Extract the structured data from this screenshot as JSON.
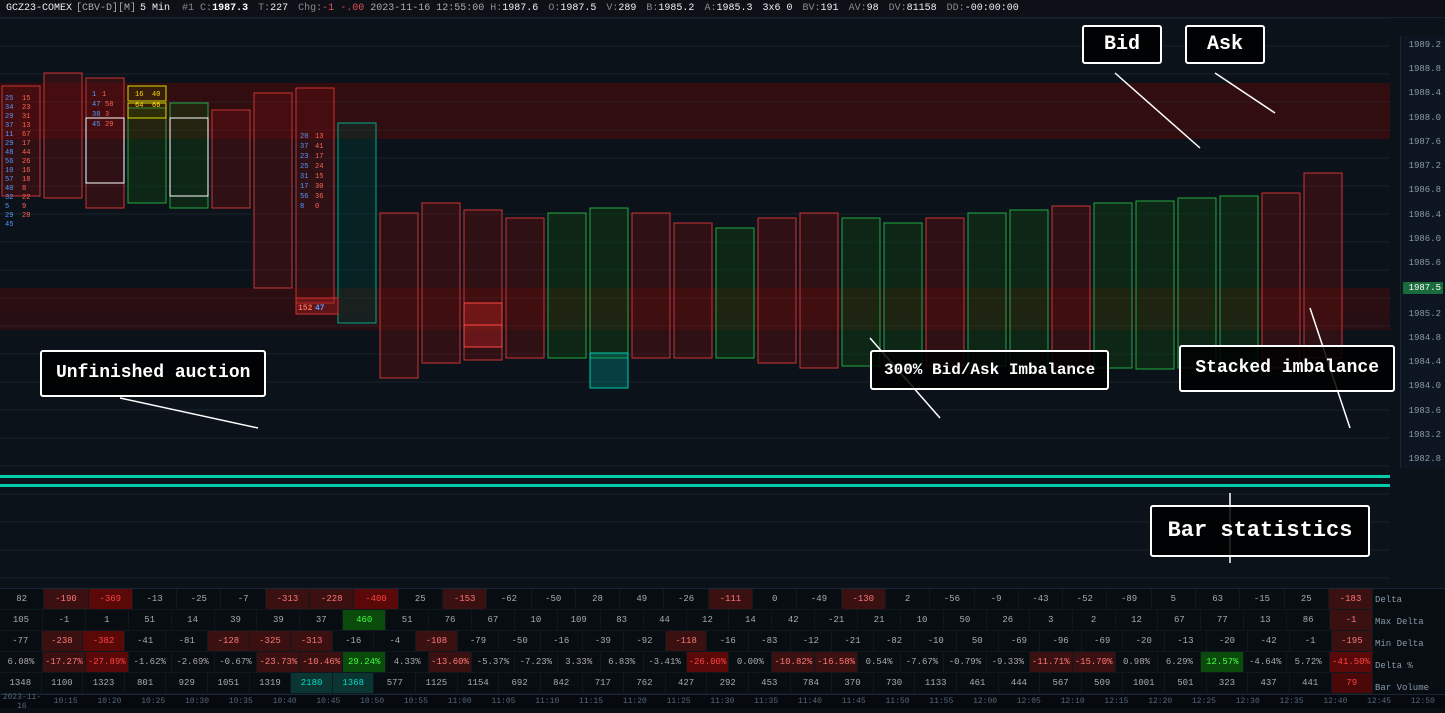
{
  "header": {
    "symbol": "GCZ23-COMEX",
    "mode": "[CBV-D][M]",
    "timeframe": "5 Min",
    "bar_num": "#1 C:",
    "close": "1987.3",
    "T": "227",
    "Chg": "-1",
    "ChgPct": "-.00",
    "date": "2023-11-16 12:55:00",
    "H": "1987.6",
    "O": "1987.5",
    "V": "289",
    "B": "1985.2",
    "A": "1985.3",
    "x3x0": "3x6 0",
    "BV": "191",
    "AV": "98",
    "DV": "81158",
    "DD": "-00:00:00"
  },
  "annotations": {
    "unfinished_auction": "Unfinished\nauction",
    "stacked_imbalance": "Stacked\nimbalance",
    "bid_ask_imbalance": "300% Bid/Ask\nImbalance",
    "bar_statistics": "Bar statistics",
    "bid_label": "Bid",
    "ask_label": "Ask"
  },
  "price_levels": [
    "1989.2",
    "1988.8",
    "1988.4",
    "1988.0",
    "1987.6",
    "1987.2",
    "1986.8",
    "1986.4",
    "1986.0",
    "1985.6",
    "1985.2",
    "1984.8",
    "1984.4",
    "1984.0",
    "1983.6",
    "1983.2",
    "1982.8"
  ],
  "current_price": "1987.5",
  "stats": {
    "rows": [
      {
        "label": "Delta",
        "cells": [
          {
            "val": "82",
            "type": "neutral"
          },
          {
            "val": "-190",
            "type": "neg"
          },
          {
            "val": "-369",
            "type": "strong-neg"
          },
          {
            "val": "-13",
            "type": "neutral"
          },
          {
            "val": "-25",
            "type": "neutral"
          },
          {
            "val": "-7",
            "type": "neutral"
          },
          {
            "val": "-313",
            "type": "neg"
          },
          {
            "val": "-228",
            "type": "neg"
          },
          {
            "val": "-400",
            "type": "strong-neg"
          },
          {
            "val": "25",
            "type": "neutral"
          },
          {
            "val": "-153",
            "type": "neg"
          },
          {
            "val": "-62",
            "type": "neutral"
          },
          {
            "val": "-50",
            "type": "neutral"
          },
          {
            "val": "28",
            "type": "neutral"
          },
          {
            "val": "49",
            "type": "neutral"
          },
          {
            "val": "-26",
            "type": "neutral"
          },
          {
            "val": "-111",
            "type": "neg"
          },
          {
            "val": "0",
            "type": "neutral"
          },
          {
            "val": "-49",
            "type": "neutral"
          },
          {
            "val": "-130",
            "type": "neg"
          },
          {
            "val": "2",
            "type": "neutral"
          },
          {
            "val": "-56",
            "type": "neutral"
          },
          {
            "val": "-9",
            "type": "neutral"
          },
          {
            "val": "-43",
            "type": "neutral"
          },
          {
            "val": "-52",
            "type": "neutral"
          },
          {
            "val": "-89",
            "type": "neutral"
          },
          {
            "val": "5",
            "type": "neutral"
          },
          {
            "val": "63",
            "type": "neutral"
          },
          {
            "val": "-15",
            "type": "neutral"
          },
          {
            "val": "25",
            "type": "neutral"
          },
          {
            "val": "-183",
            "type": "neg"
          },
          {
            "val": "Delta",
            "type": "label"
          }
        ]
      },
      {
        "label": "Max Delta",
        "cells": [
          {
            "val": "105",
            "type": "neutral"
          },
          {
            "val": "-1",
            "type": "neutral"
          },
          {
            "val": "1",
            "type": "neutral"
          },
          {
            "val": "51",
            "type": "neutral"
          },
          {
            "val": "14",
            "type": "neutral"
          },
          {
            "val": "39",
            "type": "neutral"
          },
          {
            "val": "39",
            "type": "neutral"
          },
          {
            "val": "37",
            "type": "neutral"
          },
          {
            "val": "460",
            "type": "strong-pos"
          },
          {
            "val": "51",
            "type": "neutral"
          },
          {
            "val": "76",
            "type": "neutral"
          },
          {
            "val": "67",
            "type": "neutral"
          },
          {
            "val": "10",
            "type": "neutral"
          },
          {
            "val": "109",
            "type": "neutral"
          },
          {
            "val": "83",
            "type": "neutral"
          },
          {
            "val": "44",
            "type": "neutral"
          },
          {
            "val": "12",
            "type": "neutral"
          },
          {
            "val": "14",
            "type": "neutral"
          },
          {
            "val": "42",
            "type": "neutral"
          },
          {
            "val": "-21",
            "type": "neutral"
          },
          {
            "val": "21",
            "type": "neutral"
          },
          {
            "val": "10",
            "type": "neutral"
          },
          {
            "val": "50",
            "type": "neutral"
          },
          {
            "val": "26",
            "type": "neutral"
          },
          {
            "val": "3",
            "type": "neutral"
          },
          {
            "val": "2",
            "type": "neutral"
          },
          {
            "val": "12",
            "type": "neutral"
          },
          {
            "val": "67",
            "type": "neutral"
          },
          {
            "val": "77",
            "type": "neutral"
          },
          {
            "val": "13",
            "type": "neutral"
          },
          {
            "val": "86",
            "type": "neutral"
          },
          {
            "val": "-1",
            "type": "neg"
          },
          {
            "val": "Max Delta",
            "type": "label"
          }
        ]
      },
      {
        "label": "Min Delta",
        "cells": [
          {
            "val": "-77",
            "type": "neutral"
          },
          {
            "val": "-238",
            "type": "neg"
          },
          {
            "val": "-382",
            "type": "strong-neg"
          },
          {
            "val": "-41",
            "type": "neutral"
          },
          {
            "val": "-81",
            "type": "neutral"
          },
          {
            "val": "-128",
            "type": "neg"
          },
          {
            "val": "-325",
            "type": "neg"
          },
          {
            "val": "-313",
            "type": "neg"
          },
          {
            "val": "-16",
            "type": "neutral"
          },
          {
            "val": "-4",
            "type": "neutral"
          },
          {
            "val": "-108",
            "type": "neg"
          },
          {
            "val": "-79",
            "type": "neutral"
          },
          {
            "val": "-50",
            "type": "neutral"
          },
          {
            "val": "-16",
            "type": "neutral"
          },
          {
            "val": "-39",
            "type": "neutral"
          },
          {
            "val": "-92",
            "type": "neutral"
          },
          {
            "val": "-118",
            "type": "neg"
          },
          {
            "val": "-16",
            "type": "neutral"
          },
          {
            "val": "-83",
            "type": "neutral"
          },
          {
            "val": "-12",
            "type": "neutral"
          },
          {
            "val": "-21",
            "type": "neutral"
          },
          {
            "val": "-82",
            "type": "neutral"
          },
          {
            "val": "-10",
            "type": "neutral"
          },
          {
            "val": "50",
            "type": "neutral"
          },
          {
            "val": "-69",
            "type": "neutral"
          },
          {
            "val": "-96",
            "type": "neutral"
          },
          {
            "val": "-69",
            "type": "neutral"
          },
          {
            "val": "-20",
            "type": "neutral"
          },
          {
            "val": "-13",
            "type": "neutral"
          },
          {
            "val": "-20",
            "type": "neutral"
          },
          {
            "val": "-42",
            "type": "neutral"
          },
          {
            "val": "-1",
            "type": "neutral"
          },
          {
            "val": "-195",
            "type": "neg"
          },
          {
            "val": "Min Delta",
            "type": "label"
          }
        ]
      },
      {
        "label": "Delta %",
        "cells": [
          {
            "val": "6.08%",
            "type": "neutral"
          },
          {
            "val": "-17.27%",
            "type": "neg"
          },
          {
            "val": "-27.89%",
            "type": "strong-neg"
          },
          {
            "val": "-1.62%",
            "type": "neutral"
          },
          {
            "val": "-2.69%",
            "type": "neutral"
          },
          {
            "val": "-0.67%",
            "type": "neutral"
          },
          {
            "val": "-23.73%",
            "type": "neg"
          },
          {
            "val": "-10.46%",
            "type": "neg"
          },
          {
            "val": "29.24%",
            "type": "strong-pos"
          },
          {
            "val": "4.33%",
            "type": "neutral"
          },
          {
            "val": "-13.60%",
            "type": "neg"
          },
          {
            "val": "-5.37%",
            "type": "neutral"
          },
          {
            "val": "-7.23%",
            "type": "neutral"
          },
          {
            "val": "3.33%",
            "type": "neutral"
          },
          {
            "val": "6.83%",
            "type": "neutral"
          },
          {
            "val": "-3.41%",
            "type": "neutral"
          },
          {
            "val": "-26.00%",
            "type": "strong-neg"
          },
          {
            "val": "0.00%",
            "type": "neutral"
          },
          {
            "val": "-10.82%",
            "type": "neg"
          },
          {
            "val": "-16.58%",
            "type": "neg"
          },
          {
            "val": "0.54%",
            "type": "neutral"
          },
          {
            "val": "-7.67%",
            "type": "neutral"
          },
          {
            "val": "-0.79%",
            "type": "neutral"
          },
          {
            "val": "-9.33%",
            "type": "neutral"
          },
          {
            "val": "-11.71%",
            "type": "neg"
          },
          {
            "val": "-15.70%",
            "type": "neg"
          },
          {
            "val": "0.98%",
            "type": "neutral"
          },
          {
            "val": "6.29%",
            "type": "neutral"
          },
          {
            "val": "12.57%",
            "type": "strong-pos"
          },
          {
            "val": "-4.64%",
            "type": "neutral"
          },
          {
            "val": "5.72%",
            "type": "neutral"
          },
          {
            "val": "-41.50%",
            "type": "strong-neg"
          },
          {
            "val": "Delta %",
            "type": "label"
          }
        ]
      },
      {
        "label": "Bar Volume",
        "cells": [
          {
            "val": "1348",
            "type": "neutral"
          },
          {
            "val": "1100",
            "type": "neutral"
          },
          {
            "val": "1323",
            "type": "neutral"
          },
          {
            "val": "801",
            "type": "neutral"
          },
          {
            "val": "929",
            "type": "neutral"
          },
          {
            "val": "1051",
            "type": "neutral"
          },
          {
            "val": "1319",
            "type": "neutral"
          },
          {
            "val": "2180",
            "type": "highlight-teal"
          },
          {
            "val": "1368",
            "type": "highlight-teal"
          },
          {
            "val": "577",
            "type": "neutral"
          },
          {
            "val": "1125",
            "type": "neutral"
          },
          {
            "val": "1154",
            "type": "neutral"
          },
          {
            "val": "692",
            "type": "neutral"
          },
          {
            "val": "842",
            "type": "neutral"
          },
          {
            "val": "717",
            "type": "neutral"
          },
          {
            "val": "762",
            "type": "neutral"
          },
          {
            "val": "427",
            "type": "neutral"
          },
          {
            "val": "292",
            "type": "neutral"
          },
          {
            "val": "453",
            "type": "neutral"
          },
          {
            "val": "784",
            "type": "neutral"
          },
          {
            "val": "370",
            "type": "neutral"
          },
          {
            "val": "730",
            "type": "neutral"
          },
          {
            "val": "1133",
            "type": "neutral"
          },
          {
            "val": "461",
            "type": "neutral"
          },
          {
            "val": "444",
            "type": "neutral"
          },
          {
            "val": "567",
            "type": "neutral"
          },
          {
            "val": "509",
            "type": "neutral"
          },
          {
            "val": "1001",
            "type": "neutral"
          },
          {
            "val": "501",
            "type": "neutral"
          },
          {
            "val": "323",
            "type": "neutral"
          },
          {
            "val": "437",
            "type": "neutral"
          },
          {
            "val": "441",
            "type": "neutral"
          },
          {
            "val": "79",
            "type": "highlight-red"
          },
          {
            "val": "Bar Volume",
            "type": "label"
          }
        ]
      }
    ]
  },
  "time_labels": [
    "2023-11-16",
    "10:15",
    "10:20",
    "10:25",
    "10:30",
    "10:35",
    "10:40",
    "10:45",
    "10:50",
    "10:55",
    "11:00",
    "11:05",
    "11:10",
    "11:15",
    "11:20",
    "11:25",
    "11:30",
    "11:35",
    "11:40",
    "11:45",
    "11:50",
    "11:55",
    "12:00",
    "12:05",
    "12:10",
    "12:15",
    "12:20",
    "12:25",
    "12:30",
    "12:35",
    "12:40",
    "12:45",
    "12:50"
  ]
}
